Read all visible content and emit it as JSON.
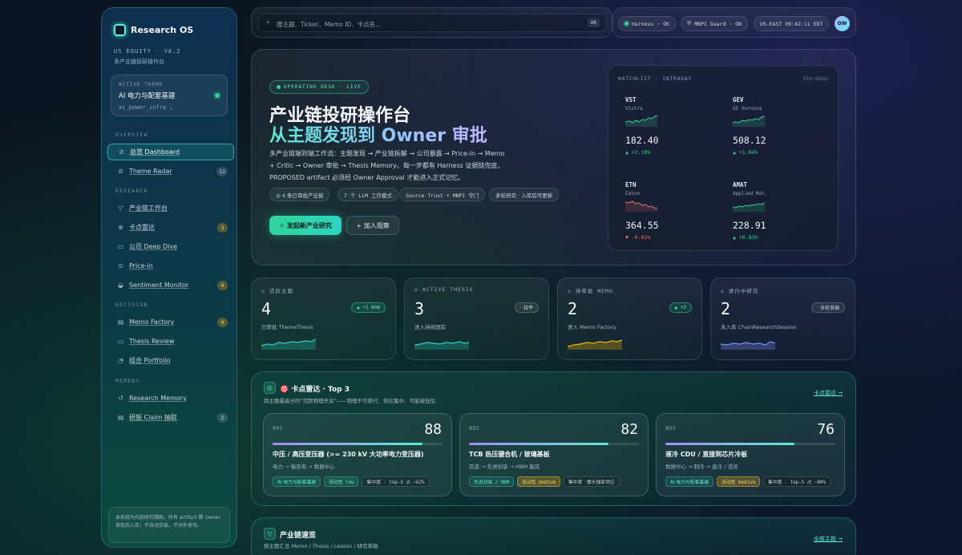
{
  "app": {
    "name": "Research OS",
    "version": "US EQUITY · V8.2",
    "subtitle": "多产业链投研操作台"
  },
  "active_theme": {
    "label": "ACTIVE THEME",
    "name": "AI 电力与配套基建",
    "code": "ai_power_infra ⌄"
  },
  "nav": {
    "overview_label": "OVERVIEW",
    "overview": [
      {
        "label": "总览 Dashboard",
        "icon": "⊘"
      },
      {
        "label": "Theme Radar",
        "icon": "⊘",
        "badge": "12"
      }
    ],
    "research_label": "RESEARCH",
    "research": [
      {
        "label": "产业链工作台",
        "icon": "▽"
      },
      {
        "label": "卡点雷达",
        "icon": "⊕",
        "badge": "3"
      },
      {
        "label": "公司 Deep Dive",
        "icon": "▭"
      },
      {
        "label": "Price-in",
        "icon": "⊙"
      },
      {
        "label": "Sentiment Monitor",
        "icon": "◒",
        "badge": "4"
      }
    ],
    "decision_label": "DECISION",
    "decision": [
      {
        "label": "Memo Factory",
        "icon": "▤",
        "badge": "4"
      },
      {
        "label": "Thesis Review",
        "icon": "▭"
      },
      {
        "label": "组合 Portfolio",
        "icon": "◔"
      }
    ],
    "memory_label": "MEMORY",
    "memory": [
      {
        "label": "Research Memory",
        "icon": "↺"
      },
      {
        "label": "研报 Claim 抽取",
        "icon": "▤",
        "badge": "2"
      }
    ]
  },
  "sidebar_note": "本系统为内部研究辅助。所有 artifact 需 Owner 审批后入库；不自动交易，不对外发布。",
  "search": {
    "placeholder": "搜主题、Ticker、Memo ID、卡点名...",
    "shortcut": "⌘K"
  },
  "status": {
    "harness": "Harness · OK",
    "mnpi": "MNPI Guard · ON",
    "clock": "US-EAST 09:42:11 EDT",
    "avatar": "OW"
  },
  "hero": {
    "pill": "OPERATING DESK · LIVE",
    "title": "产业链投研操作台",
    "title2": "从主题发现到 Owner 审批",
    "desc": "多产业链端到端工作流：主题发现 → 产业链拆解 → 公司暴露 → Price-in → Memo + Critic → Owner 审批 → Thesis Memory。每一步都有 Harness 证据链兜底，PROPOSED artifact 必须经 Owner Approval 才能进入正式记忆。",
    "tags": [
      "◎ 4 条已审批产业链",
      "7 个 LLM 工作模式",
      "Source Trust + MNPI 守门",
      "多轮研究 · 入库后可更新"
    ],
    "primary_btn": "✧ 发起新产业研究",
    "secondary_btn": "+ 加入观察"
  },
  "watchlist": {
    "title": "WATCHLIST · INTRADAY",
    "delay": "15m delay",
    "items": [
      {
        "ticker": "VST",
        "name": "Vistra",
        "price": "182.40",
        "change": "▲ +2.18%",
        "dir": "up"
      },
      {
        "ticker": "GEV",
        "name": "GE Vernova",
        "price": "508.12",
        "change": "▲ +1.04%",
        "dir": "up"
      },
      {
        "ticker": "ETN",
        "name": "Eaton",
        "price": "364.55",
        "change": "▼ -0.62%",
        "dir": "down"
      },
      {
        "ticker": "AMAT",
        "name": "Applied Mat.",
        "price": "228.91",
        "change": "▲ +0.83%",
        "dir": "up"
      }
    ]
  },
  "stats": [
    {
      "label": "◇ 活跃主题",
      "value": "4",
      "chip": "▲ +1 WoW",
      "chip_style": "green",
      "desc": "已审批 ThemeThesis",
      "color": "#2dd4bf"
    },
    {
      "label": "◇ ACTIVE THESIS",
      "value": "3",
      "chip": "· 持平",
      "chip_style": "gray",
      "desc": "进入持续跟踪",
      "color": "#2dd4bf"
    },
    {
      "label": "◇ 待审批 MEMO",
      "value": "2",
      "chip": "▲ +2",
      "chip_style": "green",
      "desc": "进入 Memo Factory",
      "color": "#eab308"
    },
    {
      "label": "◇ 进行中研究",
      "value": "2",
      "chip": "· 多轮草稿",
      "chip_style": "gray",
      "desc": "未入库 ChainResearchSession",
      "color": "#818cf8"
    }
  ],
  "chokepoints": {
    "title": "🎯 卡点雷达 · Top 3",
    "subtitle": "跨主题最高分的\"沉默物理开关\"——物理不可替代、供应集中、可能被低估",
    "link": "卡点雷达 →",
    "items": [
      {
        "no": "#01",
        "score": "88",
        "progress": 0.88,
        "title": "中压 / 高压变压器 (>= 230 kV 大功率电力变压器)",
        "path": "电力 → 输变电 → 数据中心",
        "tags": [
          {
            "t": "AI 电力与配套基建",
            "s": "tl"
          },
          {
            "t": "流动性 low",
            "s": "gr"
          },
          {
            "t": "集中度 · top-3 占 ~62%",
            "s": "dk"
          }
        ]
      },
      {
        "no": "#02",
        "score": "82",
        "progress": 0.82,
        "title": "TCB 热压键合机 / 玻璃基板",
        "path": "前道 → 先进封装 → HBM 集成",
        "tags": [
          {
            "t": "先进封装 / HBM",
            "s": "tl"
          },
          {
            "t": "流动性 medium",
            "s": "am"
          },
          {
            "t": "集中度 · 寡头独家供应",
            "s": "dk"
          }
        ]
      },
      {
        "no": "#03",
        "score": "76",
        "progress": 0.76,
        "title": "液冷 CDU / 直接到芯片冷板",
        "path": "数据中心 → 制冷 → 直冷 / 浸没",
        "tags": [
          {
            "t": "AI 电力与配套基建",
            "s": "tl"
          },
          {
            "t": "流动性 medium",
            "s": "am"
          },
          {
            "t": "集中度 · top-5 占 ~80%",
            "s": "dk"
          }
        ]
      }
    ]
  },
  "chain": {
    "title": "产业链速览",
    "subtitle": "按主题汇总 Memo / Thesis / Lesson / 研究草稿",
    "link": "全部主题 →"
  },
  "colors": {
    "accent": "#2dd4bf",
    "up": "#34d399",
    "down": "#f87171"
  }
}
